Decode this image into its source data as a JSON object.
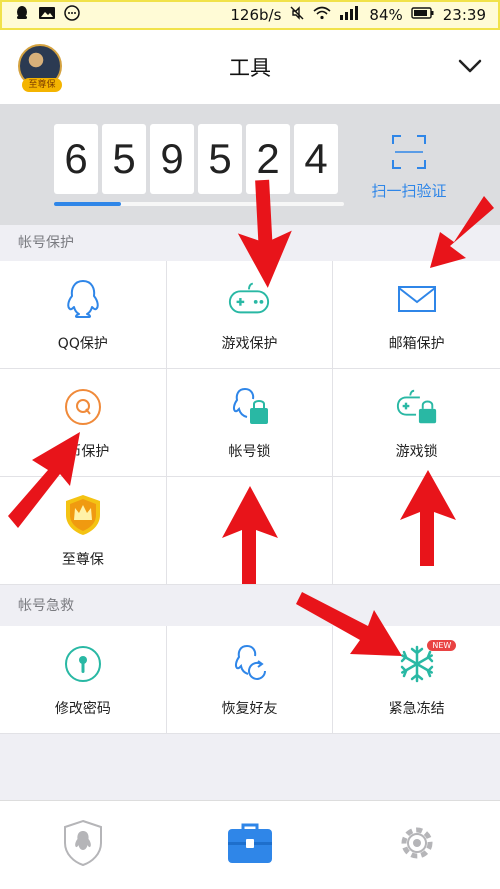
{
  "status_bar": {
    "net_speed": "126b/s",
    "signal": "4G",
    "battery": "84%",
    "time": "23:39"
  },
  "header": {
    "title": "工具",
    "avatar_badge": "至尊保"
  },
  "token": {
    "digits": [
      "6",
      "5",
      "9",
      "5",
      "2",
      "4"
    ],
    "progress_fraction": 0.23,
    "scan_label": "扫一扫验证"
  },
  "account_protection": {
    "title": "帐号保护",
    "items": [
      {
        "label": "QQ保护",
        "icon": "qq-penguin-icon"
      },
      {
        "label": "游戏保护",
        "icon": "gamepad-icon"
      },
      {
        "label": "邮箱保护",
        "icon": "mail-icon"
      },
      {
        "label": "Q币保护",
        "icon": "q-coin-icon"
      },
      {
        "label": "帐号锁",
        "icon": "account-lock-icon"
      },
      {
        "label": "游戏锁",
        "icon": "game-lock-icon"
      },
      {
        "label": "至尊保",
        "icon": "supreme-shield-icon"
      }
    ]
  },
  "emergency": {
    "title": "帐号急救",
    "items": [
      {
        "label": "修改密码",
        "icon": "password-key-icon"
      },
      {
        "label": "恢复好友",
        "icon": "restore-friends-icon"
      },
      {
        "label": "紧急冻结",
        "icon": "snowflake-icon",
        "badge": "NEW"
      }
    ]
  },
  "tabbar": {
    "tabs": [
      {
        "icon": "shield-qq-icon",
        "active": false
      },
      {
        "icon": "toolbox-icon",
        "active": true
      },
      {
        "icon": "gear-icon",
        "active": false
      }
    ]
  },
  "colors": {
    "accent": "#2f86e8",
    "teal": "#29b8a4",
    "orange": "#f08a3a",
    "arrow": "#e8141a"
  }
}
